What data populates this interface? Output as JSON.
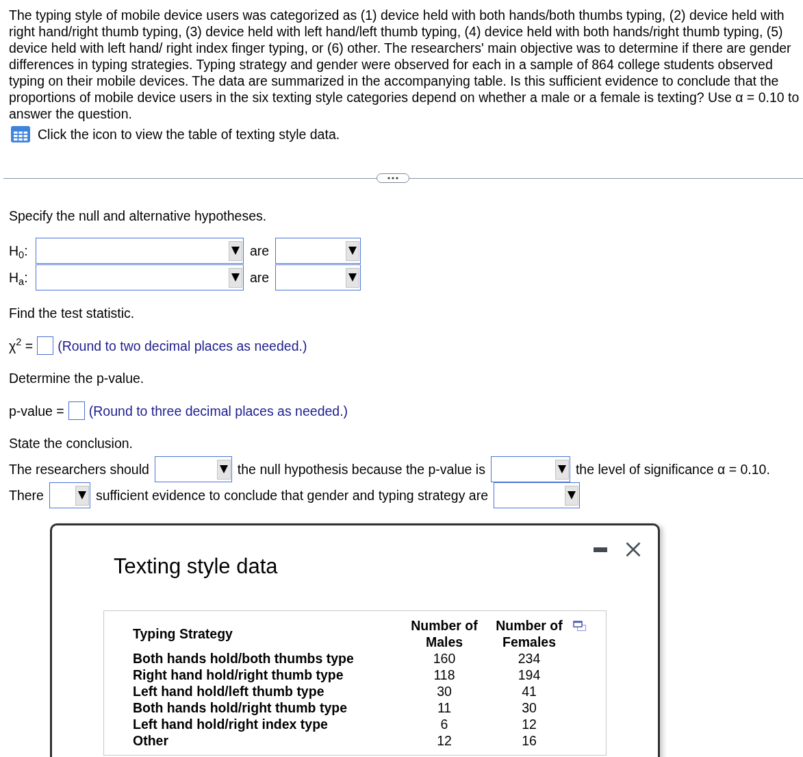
{
  "problem": {
    "text": "The typing style of mobile device users was categorized as (1) device held with both hands/both thumbs typing, (2) device held with right hand/right thumb typing, (3) device held with left hand/left thumb typing, (4) device held with both hands/right thumb typing, (5) device held with left hand/ right index finger typing, or (6) other. The researchers' main objective was to determine if there are gender differences in typing strategies. Typing strategy and gender were observed for each in a sample of 864 college students observed typing on their mobile devices. The data are summarized in the accompanying table. Is this sufficient evidence to conclude that the proportions of mobile device users in the six texting style categories depend on whether a male or a female is texting? Use α = 0.10 to answer the question.",
    "data_link": "Click the icon to view the table of texting style data."
  },
  "hypotheses": {
    "prompt": "Specify the null and alternative hypotheses.",
    "rows": [
      {
        "label": "H$_{0}$:",
        "connector": "are"
      },
      {
        "label": "H$_{a}$:",
        "connector": "are"
      }
    ]
  },
  "steps": [
    {
      "prompt": "Find the test statistic.",
      "answer_label": "χ$^{2}$ =",
      "hint": "(Round to two decimal places as needed.)"
    },
    {
      "prompt": "Determine the p-value.",
      "answer_label": "p-value =",
      "hint": "(Round to three decimal places as needed.)"
    }
  ],
  "conclusion": {
    "prompt": "State the conclusion.",
    "lines": [
      [
        {
          "kind": "text",
          "text": "The researchers should"
        },
        {
          "kind": "dropdown"
        },
        {
          "kind": "text",
          "text": "the null hypothesis because the p-value is"
        },
        {
          "kind": "dropdown"
        },
        {
          "kind": "text",
          "text": "the level of significance α = 0.10."
        }
      ],
      [
        {
          "kind": "text",
          "text": "There"
        },
        {
          "kind": "dropdown"
        },
        {
          "kind": "text",
          "text": "sufficient evidence to conclude that gender and typing strategy are"
        },
        {
          "kind": "dropdown"
        }
      ]
    ]
  },
  "dialog": {
    "title": "Texting style data",
    "columns": [
      "Typing Strategy",
      "Number of Males",
      "Number of Females"
    ],
    "rows": [
      {
        "strategy": "Both hands hold/both thumbs type",
        "males": "160",
        "females": "234"
      },
      {
        "strategy": "Right hand hold/right thumb type",
        "males": "118",
        "females": "194"
      },
      {
        "strategy": "Left hand hold/left thumb type",
        "males": "30",
        "females": "41"
      },
      {
        "strategy": "Both hands hold/right thumb type",
        "males": "11",
        "females": "30"
      },
      {
        "strategy": "Left hand hold/right index type",
        "males": "6",
        "females": "12"
      },
      {
        "strategy": "Other",
        "males": "12",
        "females": "16"
      }
    ]
  }
}
